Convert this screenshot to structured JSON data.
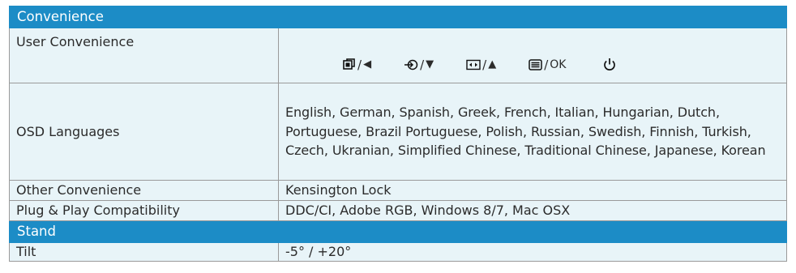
{
  "sections": {
    "convenience": "Convenience",
    "stand": "Stand"
  },
  "rows": {
    "user_convenience": {
      "label": "User Convenience"
    },
    "osd_languages": {
      "label": "OSD Languages",
      "value": "English, German, Spanish, Greek, French, Italian, Hungarian, Dutch, Portuguese, Brazil Portuguese, Polish, Russian, Swedish, Finnish, Turkish, Czech, Ukranian, Simplified Chinese, Traditional Chinese, Japanese, Korean"
    },
    "other_convenience": {
      "label": "Other Convenience",
      "value": "Kensington Lock"
    },
    "plug_play": {
      "label": "Plug & Play Compatibility",
      "value": "DDC/CI, Adobe RGB, Windows 8/7, Mac OSX"
    },
    "tilt": {
      "label": "Tilt",
      "value": "-5° / +20°"
    }
  },
  "keys": {
    "smartimage": {
      "sep": "/",
      "glyph": "◀",
      "icon": "smartimage-icon"
    },
    "input": {
      "sep": "/",
      "glyph": "▼",
      "icon": "input-icon"
    },
    "format": {
      "sep": "/",
      "glyph": "▲",
      "icon": "format-icon"
    },
    "menu": {
      "sep": "/",
      "label": "OK",
      "icon": "menu-icon"
    },
    "power": {
      "icon": "power-icon"
    }
  },
  "colors": {
    "section_header": "#1c8cc6",
    "row_background": "#e8f4f8",
    "border": "#9a9a9a"
  }
}
